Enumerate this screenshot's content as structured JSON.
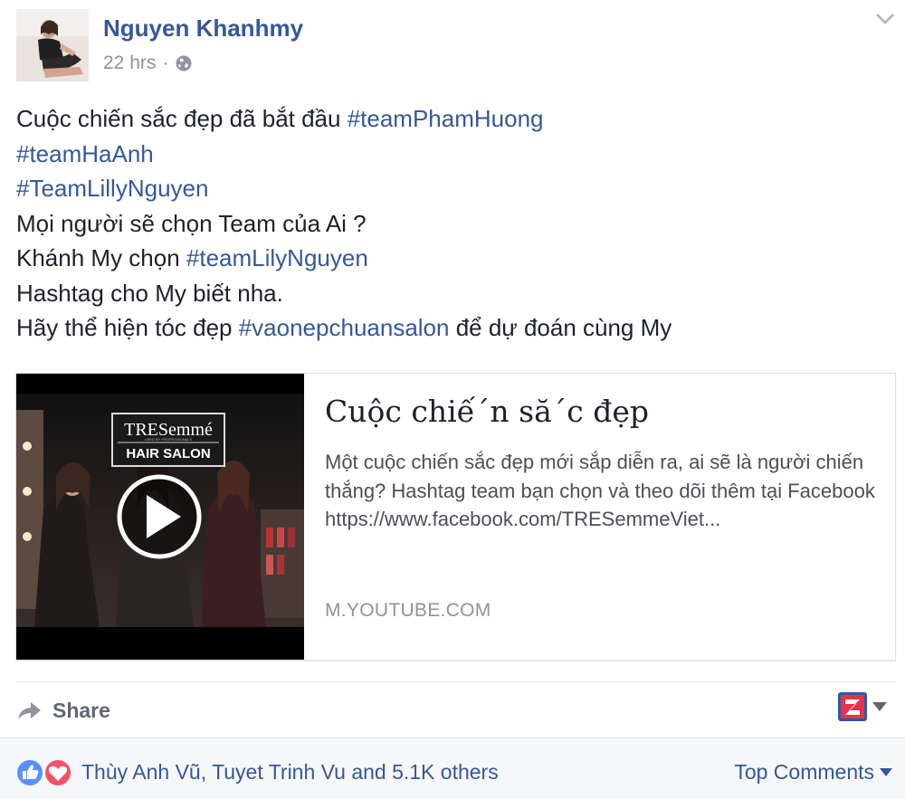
{
  "post": {
    "author": "Nguyen Khanhmy",
    "time": "22 hrs",
    "separator": "·",
    "privacy_icon": "globe-icon",
    "menu_icon": "chevron-down-icon",
    "text_lines": [
      [
        {
          "t": "Cuộc chiến sắc đẹp đã bắt đầu ",
          "tag": false
        },
        {
          "t": "#teamPhamHuong",
          "tag": true
        }
      ],
      [
        {
          "t": "#teamHaAnh",
          "tag": true
        }
      ],
      [
        {
          "t": "#TeamLillyNguyen",
          "tag": true
        }
      ],
      [
        {
          "t": "Mọi người sẽ chọn Team của Ai ?",
          "tag": false
        }
      ],
      [
        {
          "t": "Khánh My chọn ",
          "tag": false
        },
        {
          "t": "#teamLilyNguyen",
          "tag": true
        }
      ],
      [
        {
          "t": "Hashtag cho My biết nha.",
          "tag": false
        }
      ],
      [
        {
          "t": "Hãy thể hiện tóc đẹp ",
          "tag": false
        },
        {
          "t": "#vaonepchuansalon",
          "tag": true
        },
        {
          "t": " để dự đoán cùng My",
          "tag": false
        }
      ]
    ]
  },
  "link_card": {
    "title": "Cuộc chiế´n să´c đẹp",
    "description": "Một cuộc chiến sắc đẹp mới sắp diễn ra, ai sẽ là người chiến thắng? Hashtag team bạn chọn và theo dõi thêm tại Facebook https://www.facebook.com/TRESemmeViet...",
    "domain": "M.YOUTUBE.COM",
    "thumbnail": {
      "brand": "TRESemmé",
      "brand_sub": "USED BY PROFESSIONALS",
      "badge": "HAIR SALON",
      "play_icon": "play-icon"
    }
  },
  "actions": {
    "share_label": "Share",
    "share_icon": "share-arrow-icon",
    "app_icon": "z-app-icon"
  },
  "reactions": {
    "icons": [
      "like-icon",
      "love-icon"
    ],
    "summary": "Thùy Anh Vũ, Tuyet Trinh Vu and 5.1K others",
    "sort_label": "Top Comments"
  },
  "colors": {
    "link": "#365899",
    "text": "#1d2129",
    "muted": "#90949c",
    "like": "#5890ff",
    "love": "#f25268"
  }
}
